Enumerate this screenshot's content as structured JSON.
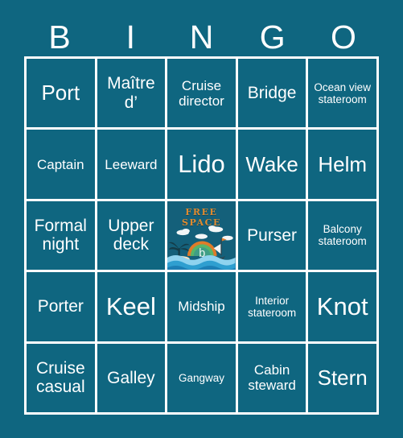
{
  "card": {
    "background_color": "#0f6680",
    "grid_line_color": "#ffffff",
    "text_color": "#ffffff",
    "free_space_accent_color": "#e08a2e"
  },
  "header": {
    "letters": [
      "B",
      "I",
      "N",
      "G",
      "O"
    ]
  },
  "grid": {
    "rows": [
      [
        {
          "label": "Port",
          "size": "lg"
        },
        {
          "label": "Maître d’",
          "size": "md"
        },
        {
          "label": "Cruise director",
          "size": "sm"
        },
        {
          "label": "Bridge",
          "size": "md"
        },
        {
          "label": "Ocean view stateroom",
          "size": "xs"
        }
      ],
      [
        {
          "label": "Captain",
          "size": "sm"
        },
        {
          "label": "Leeward",
          "size": "sm"
        },
        {
          "label": "Lido",
          "size": "xl"
        },
        {
          "label": "Wake",
          "size": "lg"
        },
        {
          "label": "Helm",
          "size": "lg"
        }
      ],
      [
        {
          "label": "Formal night",
          "size": "md"
        },
        {
          "label": "Upper deck",
          "size": "md"
        },
        {
          "label": "FREE SPACE",
          "size": "free"
        },
        {
          "label": "Purser",
          "size": "md"
        },
        {
          "label": "Balcony stateroom",
          "size": "xs"
        }
      ],
      [
        {
          "label": "Porter",
          "size": "md"
        },
        {
          "label": "Keel",
          "size": "xl"
        },
        {
          "label": "Midship",
          "size": "sm"
        },
        {
          "label": "Interior stateroom",
          "size": "xs"
        },
        {
          "label": "Knot",
          "size": "xl"
        }
      ],
      [
        {
          "label": "Cruise casual",
          "size": "md"
        },
        {
          "label": "Galley",
          "size": "md"
        },
        {
          "label": "Gangway",
          "size": "xs"
        },
        {
          "label": "Cabin steward",
          "size": "sm"
        },
        {
          "label": "Stern",
          "size": "lg"
        }
      ]
    ]
  },
  "free_space": {
    "line1": "FREE",
    "line2": "SPACE",
    "logo_text": "b",
    "art_description": "island-scene"
  }
}
